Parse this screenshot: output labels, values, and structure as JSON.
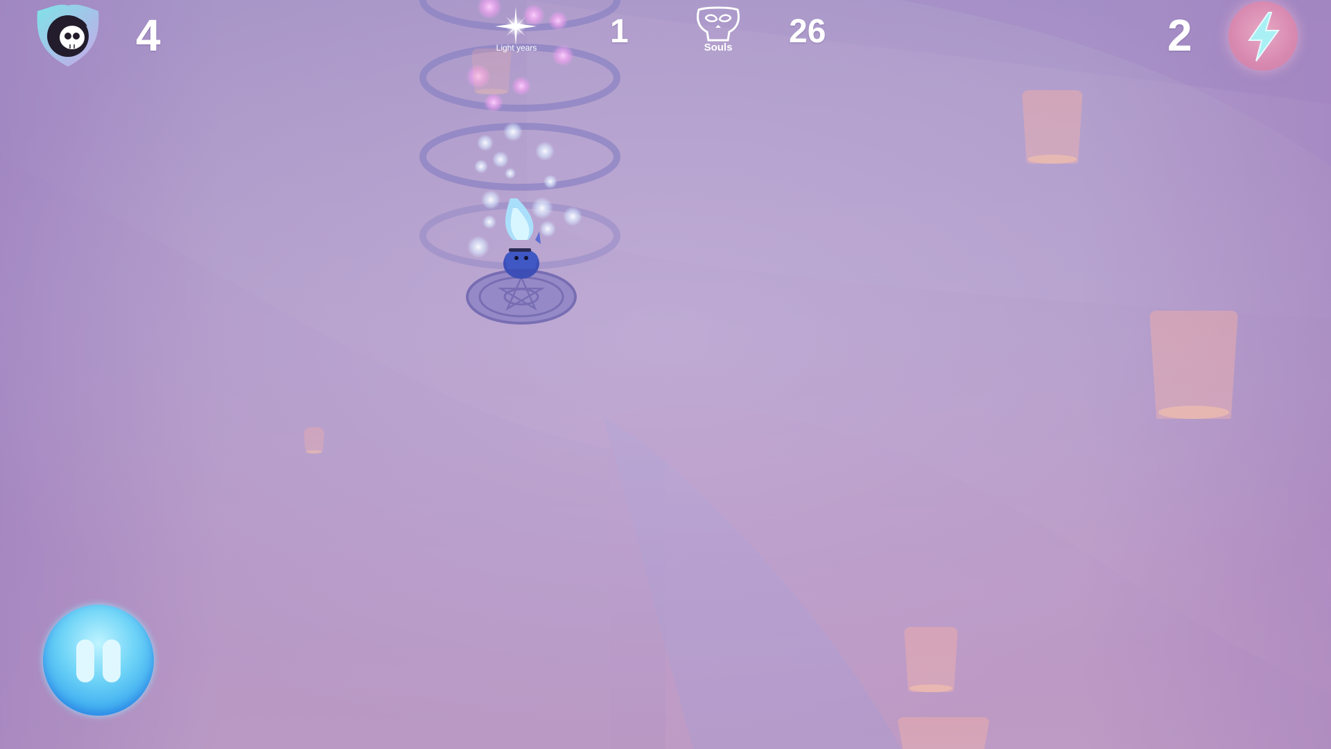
{
  "hud": {
    "lives": "4",
    "distance": {
      "value": "1",
      "label": "Light years"
    },
    "souls": {
      "value": "26",
      "label": "Souls"
    },
    "energy": "2"
  },
  "icons": {
    "lives_badge": "skull-badge-icon",
    "distance": "star-sparkle-icon",
    "souls": "souls-skull-icon",
    "energy": "lightning-bolt-icon",
    "pause": "pause-icon"
  },
  "colors": {
    "pause_button": "#2ea0ee",
    "energy_button": "#d889b0",
    "background": "#b29cc9",
    "hud_text": "#ffffff"
  }
}
